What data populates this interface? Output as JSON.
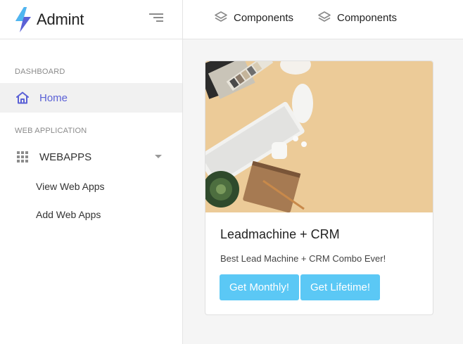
{
  "brand": {
    "name": "Admint",
    "logo_icon": "bolt-logo-icon"
  },
  "colors": {
    "accent": "#5b61d6",
    "button": "#5bc8f5",
    "active_bg": "#f1f1f1"
  },
  "sidebar": {
    "sections": [
      {
        "title": "DASHBOARD"
      },
      {
        "title": "WEB APPLICATION"
      }
    ],
    "home": {
      "label": "Home",
      "icon": "home-icon"
    },
    "webapps": {
      "label": "WEBAPPS",
      "icon": "grid-icon",
      "children": [
        {
          "label": "View Web Apps"
        },
        {
          "label": "Add Web Apps"
        }
      ]
    }
  },
  "topbar": {
    "links": [
      {
        "label": "Components",
        "icon": "layers-icon"
      },
      {
        "label": "Components",
        "icon": "layers-icon"
      }
    ]
  },
  "card": {
    "title": "Leadmachine + CRM",
    "text": "Best Lead Machine + CRM Combo Ever!",
    "buttons": [
      {
        "label": "Get Monthly!"
      },
      {
        "label": "Get Lifetime!"
      }
    ]
  }
}
